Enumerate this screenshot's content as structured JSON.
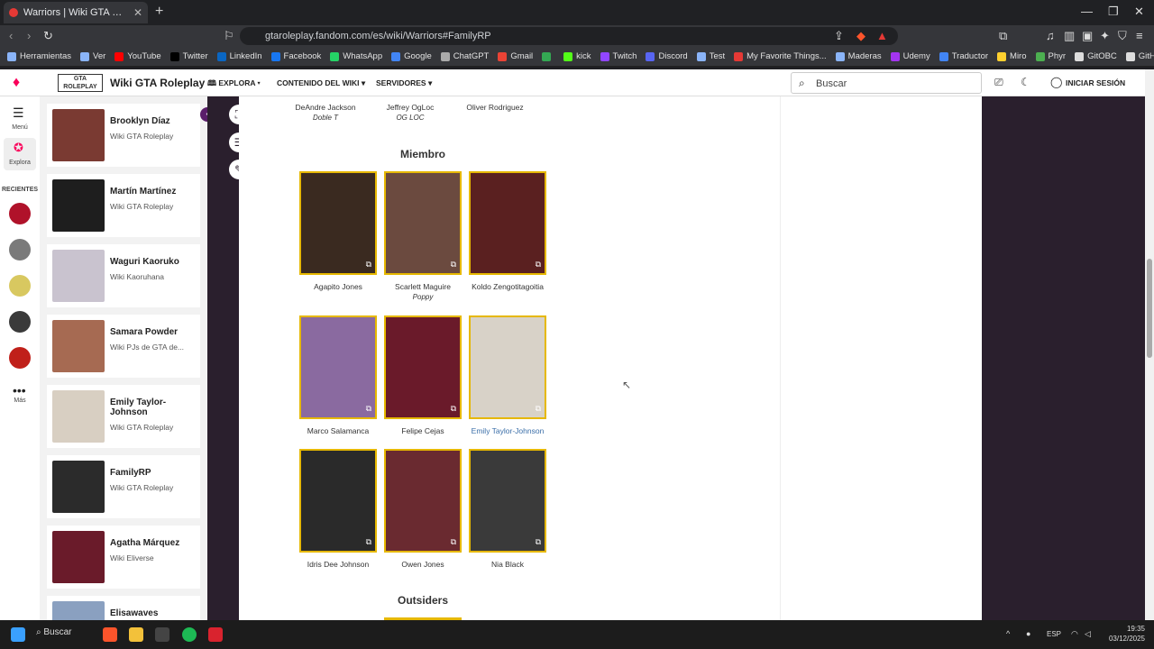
{
  "browser": {
    "tab_title": "Warriors | Wiki GTA Roleplay | Fa",
    "url": "gtaroleplay.fandom.com/es/wiki/Warriors#FamilyRP",
    "bookmarks": [
      {
        "label": "Herramientas",
        "color": "#8ab4f8"
      },
      {
        "label": "Ver",
        "color": "#8ab4f8"
      },
      {
        "label": "YouTube",
        "color": "#ff0000"
      },
      {
        "label": "Twitter",
        "color": "#000000"
      },
      {
        "label": "LinkedIn",
        "color": "#0a66c2"
      },
      {
        "label": "Facebook",
        "color": "#1877f2"
      },
      {
        "label": "WhatsApp",
        "color": "#25d366"
      },
      {
        "label": "Google",
        "color": "#4285f4"
      },
      {
        "label": "ChatGPT",
        "color": "#aaaaaa"
      },
      {
        "label": "Gmail",
        "color": "#ea4335"
      },
      {
        "label": "",
        "color": "#34a853"
      },
      {
        "label": "kick",
        "color": "#53fc18"
      },
      {
        "label": "Twitch",
        "color": "#9146ff"
      },
      {
        "label": "Discord",
        "color": "#5865f2"
      },
      {
        "label": "Test",
        "color": "#8ab4f8"
      },
      {
        "label": "My Favorite Things...",
        "color": "#e53935"
      },
      {
        "label": "Maderas",
        "color": "#8ab4f8"
      },
      {
        "label": "Udemy",
        "color": "#a435f0"
      },
      {
        "label": "Traductor",
        "color": "#4285f4"
      },
      {
        "label": "Miro",
        "color": "#ffd02f"
      },
      {
        "label": "Phyr",
        "color": "#4caf50"
      },
      {
        "label": "GitOBC",
        "color": "#dddddd"
      },
      {
        "label": "GitHub",
        "color": "#dddddd"
      }
    ]
  },
  "wiki": {
    "logo_text": "Wiki GTA Roleplay",
    "nav": [
      "EXPLORA",
      "CONTENIDO DEL WIKI",
      "SERVIDORES"
    ],
    "search_placeholder": "Buscar",
    "login_label": "INICIAR SESIÓN",
    "accent": "#e6b800"
  },
  "rail": {
    "menu_label": "Menú",
    "explore_label": "Explora",
    "recents_label": "RECIENTES",
    "more_label": "Más"
  },
  "recents": [
    {
      "name": "Brooklyn Díaz",
      "wiki": "Wiki GTA Roleplay",
      "color": "#7a3a32"
    },
    {
      "name": "Martín Martínez",
      "wiki": "Wiki GTA Roleplay",
      "color": "#1e1e1e"
    },
    {
      "name": "Waguri Kaoruko",
      "wiki": "Wiki Kaoruhana",
      "color": "#c9c3cf"
    },
    {
      "name": "Samara Powder",
      "wiki": "Wiki PJs de GTA de...",
      "color": "#a66a52"
    },
    {
      "name": "Emily Taylor-Johnson",
      "wiki": "Wiki GTA Roleplay",
      "color": "#d8cfc2"
    },
    {
      "name": "FamilyRP",
      "wiki": "Wiki GTA Roleplay",
      "color": "#2b2b2b"
    },
    {
      "name": "Agatha Márquez",
      "wiki": "Wiki Eliverse",
      "color": "#6a1b2a"
    },
    {
      "name": "Elisawaves",
      "wiki": "",
      "color": "#8aa0c0"
    }
  ],
  "content": {
    "top_row": [
      {
        "name": "DeAndre Jackson",
        "alias": "Doble T"
      },
      {
        "name": "Jeffrey OgLoc",
        "alias": "OG LOC"
      },
      {
        "name": "Oliver Rodriguez",
        "alias": ""
      }
    ],
    "section_member": "Miembro",
    "members": [
      {
        "name": "Agapito Jones",
        "alias": "",
        "color": "#3a2a20"
      },
      {
        "name": "Scarlett Maguire",
        "alias": "Poppy",
        "color": "#6b4a3f"
      },
      {
        "name": "Koldo Zengotitagoitia",
        "alias": "",
        "color": "#5a2020"
      },
      {
        "name": "Marco Salamanca",
        "alias": "",
        "color": "#8a6aa0"
      },
      {
        "name": "Felipe Cejas",
        "alias": "",
        "color": "#6a1a2a"
      },
      {
        "name": "Emily Taylor-Johnson",
        "alias": "",
        "color": "#d8d2c8"
      },
      {
        "name": "Idris Dee Johnson",
        "alias": "",
        "color": "#2a2a2a"
      },
      {
        "name": "Owen Jones",
        "alias": "",
        "color": "#6a2a30"
      },
      {
        "name": "Nia Black",
        "alias": "",
        "color": "#3a3a3a"
      }
    ],
    "section_outsiders": "Outsiders"
  },
  "taskbar": {
    "search_label": "Buscar",
    "lang": "ESP",
    "time": "19:35",
    "date": "03/12/2025"
  }
}
